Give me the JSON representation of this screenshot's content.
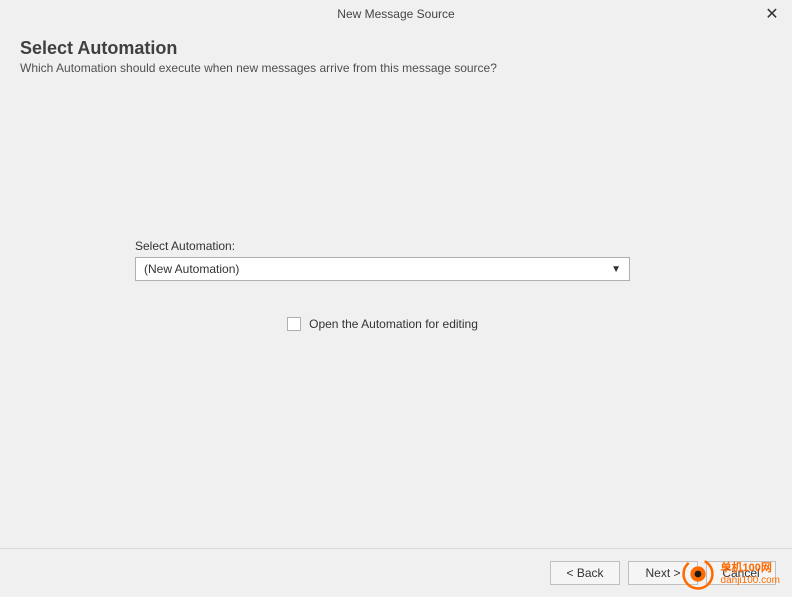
{
  "titlebar": {
    "title": "New Message Source"
  },
  "header": {
    "title": "Select Automation",
    "subtitle": "Which Automation should execute when new messages arrive from this message source?"
  },
  "form": {
    "select_label": "Select Automation:",
    "selected_value": "(New Automation)",
    "checkbox_label": "Open the Automation for editing",
    "checkbox_checked": false
  },
  "footer": {
    "back_label": "< Back",
    "next_label": "Next >",
    "cancel_label": "Cancel"
  },
  "watermark": {
    "cn": "单机100网",
    "url": "danji100.com"
  }
}
